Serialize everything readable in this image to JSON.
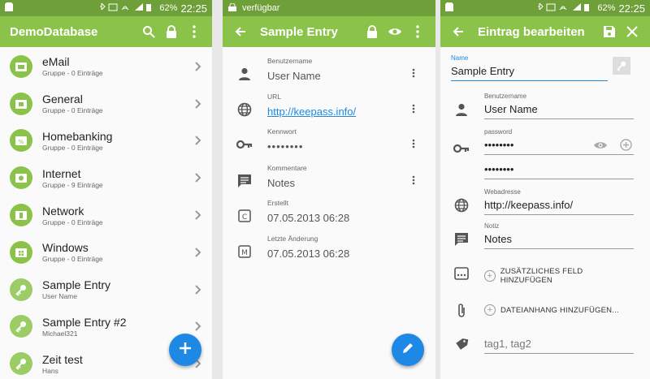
{
  "colors": {
    "primary": "#8bc34a",
    "primary_dark": "#6f9f38",
    "fab": "#1e88e5",
    "link": "#1e88e5"
  },
  "statusbar": {
    "battery": "62%",
    "time": "22:25",
    "center_notice": "verfügbar"
  },
  "groups_screen": {
    "title": "DemoDatabase",
    "items": [
      {
        "title": "eMail",
        "subtitle": "Gruppe - 0 Einträge",
        "icon": "folder-mail-icon"
      },
      {
        "title": "General",
        "subtitle": "Gruppe - 0 Einträge",
        "icon": "folder-general-icon"
      },
      {
        "title": "Homebanking",
        "subtitle": "Gruppe - 0 Einträge",
        "icon": "folder-percent-icon"
      },
      {
        "title": "Internet",
        "subtitle": "Gruppe - 9 Einträge",
        "icon": "folder-globe-icon"
      },
      {
        "title": "Network",
        "subtitle": "Gruppe - 0 Einträge",
        "icon": "folder-network-icon"
      },
      {
        "title": "Windows",
        "subtitle": "Gruppe - 0 Einträge",
        "icon": "folder-windows-icon"
      },
      {
        "title": "Sample Entry",
        "subtitle": "User Name",
        "icon": "key-icon"
      },
      {
        "title": "Sample Entry #2",
        "subtitle": "Michael321",
        "icon": "key-icon"
      },
      {
        "title": "Zeit test",
        "subtitle": "Hans",
        "icon": "key-icon"
      }
    ]
  },
  "entry_screen": {
    "title": "Sample Entry",
    "fields": [
      {
        "label": "Benutzername",
        "value": "User Name",
        "icon": "person-icon"
      },
      {
        "label": "URL",
        "value": "http://keepass.info/",
        "icon": "globe-icon"
      },
      {
        "label": "Kennwort",
        "value": "••••••••",
        "icon": "key-icon"
      },
      {
        "label": "Kommentare",
        "value": "Notes",
        "icon": "comment-icon"
      },
      {
        "label": "Erstellt",
        "value": "07.05.2013 06:28",
        "icon": "created-icon"
      },
      {
        "label": "Letzte Änderung",
        "value": "07.05.2013 06:28",
        "icon": "modified-icon"
      }
    ]
  },
  "edit_screen": {
    "title": "Eintrag bearbeiten",
    "name_label": "Name",
    "name_value": "Sample Entry",
    "username_label": "Benutzername",
    "username_value": "User Name",
    "password_label": "password",
    "password_value": "••••••••",
    "password_repeat_value": "••••••••",
    "url_label": "Webadresse",
    "url_value": "http://keepass.info/",
    "notes_label": "Notiz",
    "notes_value": "Notes",
    "add_field_label": "ZUSÄTZLICHES FELD HINZUFÜGEN",
    "add_attachment_label": "DATEIANHANG HINZUFÜGEN...",
    "tags_placeholder": "tag1, tag2"
  }
}
